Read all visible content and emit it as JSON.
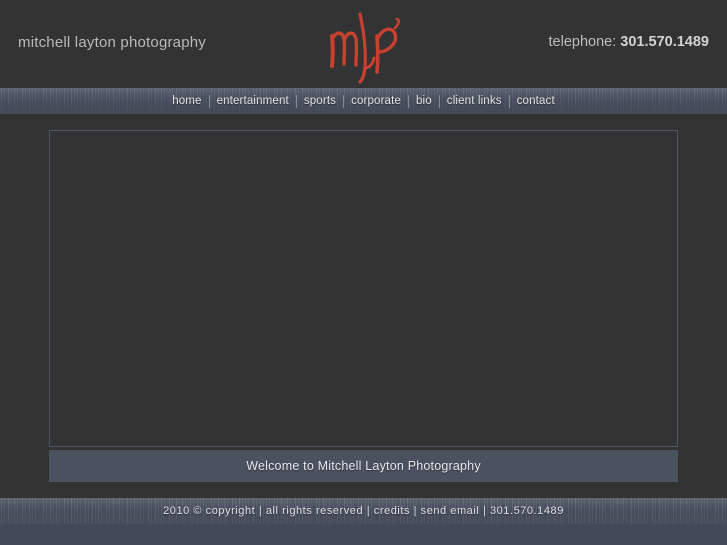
{
  "site": {
    "background_color": "#333333",
    "accent_color": "#c8402f",
    "bar_color": "#4a5260"
  },
  "header": {
    "brand": "mitchell layton photography",
    "phone_label": "telephone: ",
    "phone_number": "301.570.1489",
    "logo_text": "mlp",
    "logo_name": "mlp-script-logo"
  },
  "nav": {
    "items": [
      {
        "label": "home"
      },
      {
        "label": "entertainment"
      },
      {
        "label": "sports"
      },
      {
        "label": "corporate"
      },
      {
        "label": "bio"
      },
      {
        "label": "client links"
      },
      {
        "label": "contact"
      }
    ]
  },
  "main": {
    "stage_caption": "Welcome to Mitchell Layton Photography"
  },
  "footer": {
    "year_copyright": "2010 © copyright",
    "sep1": " | ",
    "rights": "all rights reserved",
    "sep2": " | ",
    "credits": "credits",
    "sep3": " | ",
    "send_email": "send email",
    "sep4": " | ",
    "phone": "301.570.1489"
  }
}
